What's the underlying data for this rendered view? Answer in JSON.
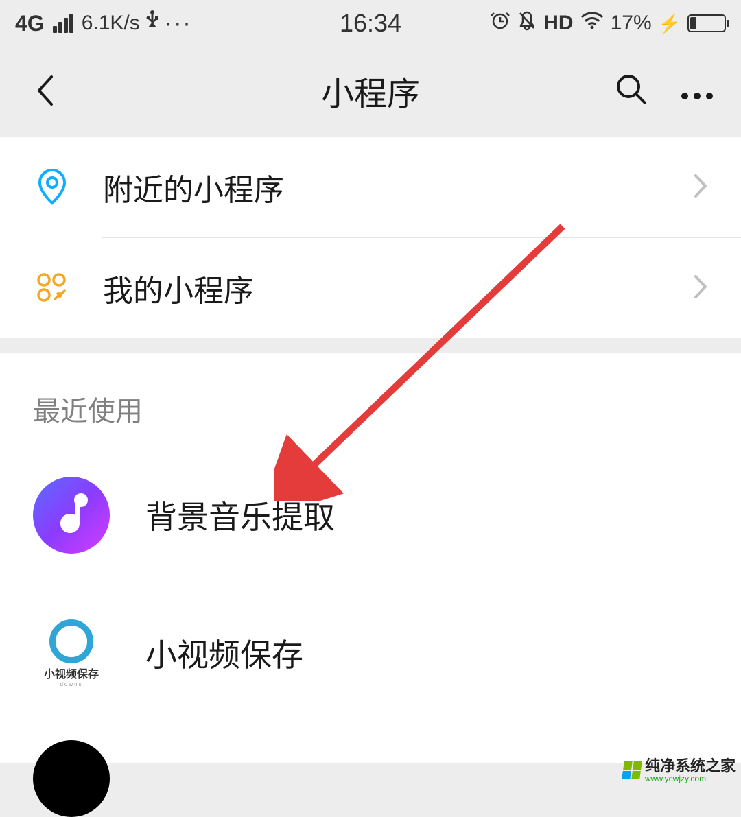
{
  "statusBar": {
    "network": "4G",
    "speed": "6.1K/s",
    "usb": "✝",
    "more": "···",
    "time": "16:34",
    "hd": "HD",
    "batteryPct": "17%"
  },
  "nav": {
    "title": "小程序"
  },
  "topList": [
    {
      "label": "附近的小程序",
      "icon": "location"
    },
    {
      "label": "我的小程序",
      "icon": "grid"
    }
  ],
  "recentSection": {
    "header": "最近使用",
    "apps": [
      {
        "name": "背景音乐提取",
        "iconType": "music"
      },
      {
        "name": "小视频保存",
        "iconType": "video",
        "subLabel": "小视频保存",
        "subLabel2": "downs"
      },
      {
        "name": "",
        "iconType": "black"
      }
    ]
  },
  "watermark": {
    "main": "纯净系统之家",
    "sub": "www.ycwjzy.com"
  }
}
